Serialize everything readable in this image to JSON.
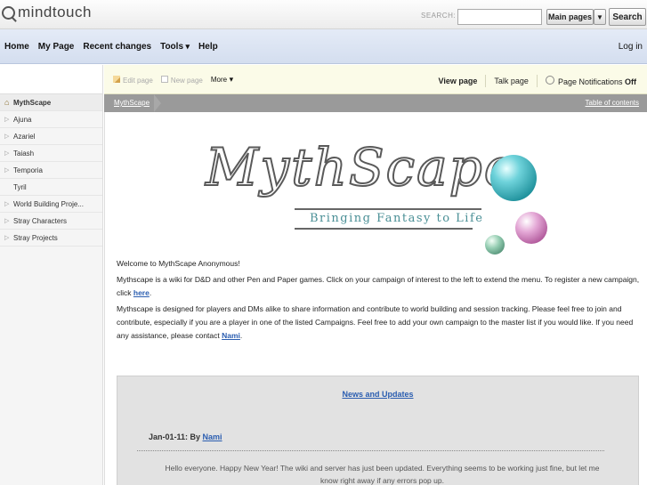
{
  "topbar": {
    "logo_text": "mindtouch",
    "search_label": "SEARCH:",
    "search_value": "",
    "scope_label": "Main pages",
    "search_button": "Search"
  },
  "nav": {
    "items": [
      "Home",
      "My Page",
      "Recent changes",
      "Tools",
      "Help"
    ],
    "login": "Log in"
  },
  "sidebar": {
    "items": [
      {
        "label": "MythScape"
      },
      {
        "label": "Ajuna"
      },
      {
        "label": "Azariel"
      },
      {
        "label": "Taiash"
      },
      {
        "label": "Temporia"
      },
      {
        "label": "Tyril"
      },
      {
        "label": "World Building Proje..."
      },
      {
        "label": "Stray Characters"
      },
      {
        "label": "Stray Projects"
      }
    ]
  },
  "toolbar": {
    "edit": "Edit page",
    "new": "New page",
    "more": "More",
    "view": "View page",
    "talk": "Talk page",
    "notify": "Page Notifications",
    "notify_state": "Off"
  },
  "breadcrumb": {
    "current": "MythScape",
    "toc": "Table of contents"
  },
  "banner": {
    "title": "MythScape",
    "subtitle": "Bringing Fantasy to Life"
  },
  "content": {
    "welcome": "Welcome  to MythScape Anonymous!",
    "p1_text": "Mythscape is a wiki for D&D and other Pen and Paper games. Click on your campaign of interest to the left to extend the menu. To register a new campaign, click ",
    "p1_link": "here",
    "p2_text": "Mythscape is designed for players and DMs alike to share information and contribute to world building and session tracking. Please feel free to join and contribute, especially if you are a player in one of the listed Campaigns. Feel free to add your own campaign to the master list if you would like. If you need any assistance, please contact ",
    "p2_link": "Nami"
  },
  "news": {
    "title": "News and Updates",
    "date_prefix": "Jan-01-11: By ",
    "author": "Nami",
    "body": "Hello everyone. Happy New Year! The wiki and server has just been updated. Everything seems to be working just fine, but let me know right away if any errors pop up."
  }
}
